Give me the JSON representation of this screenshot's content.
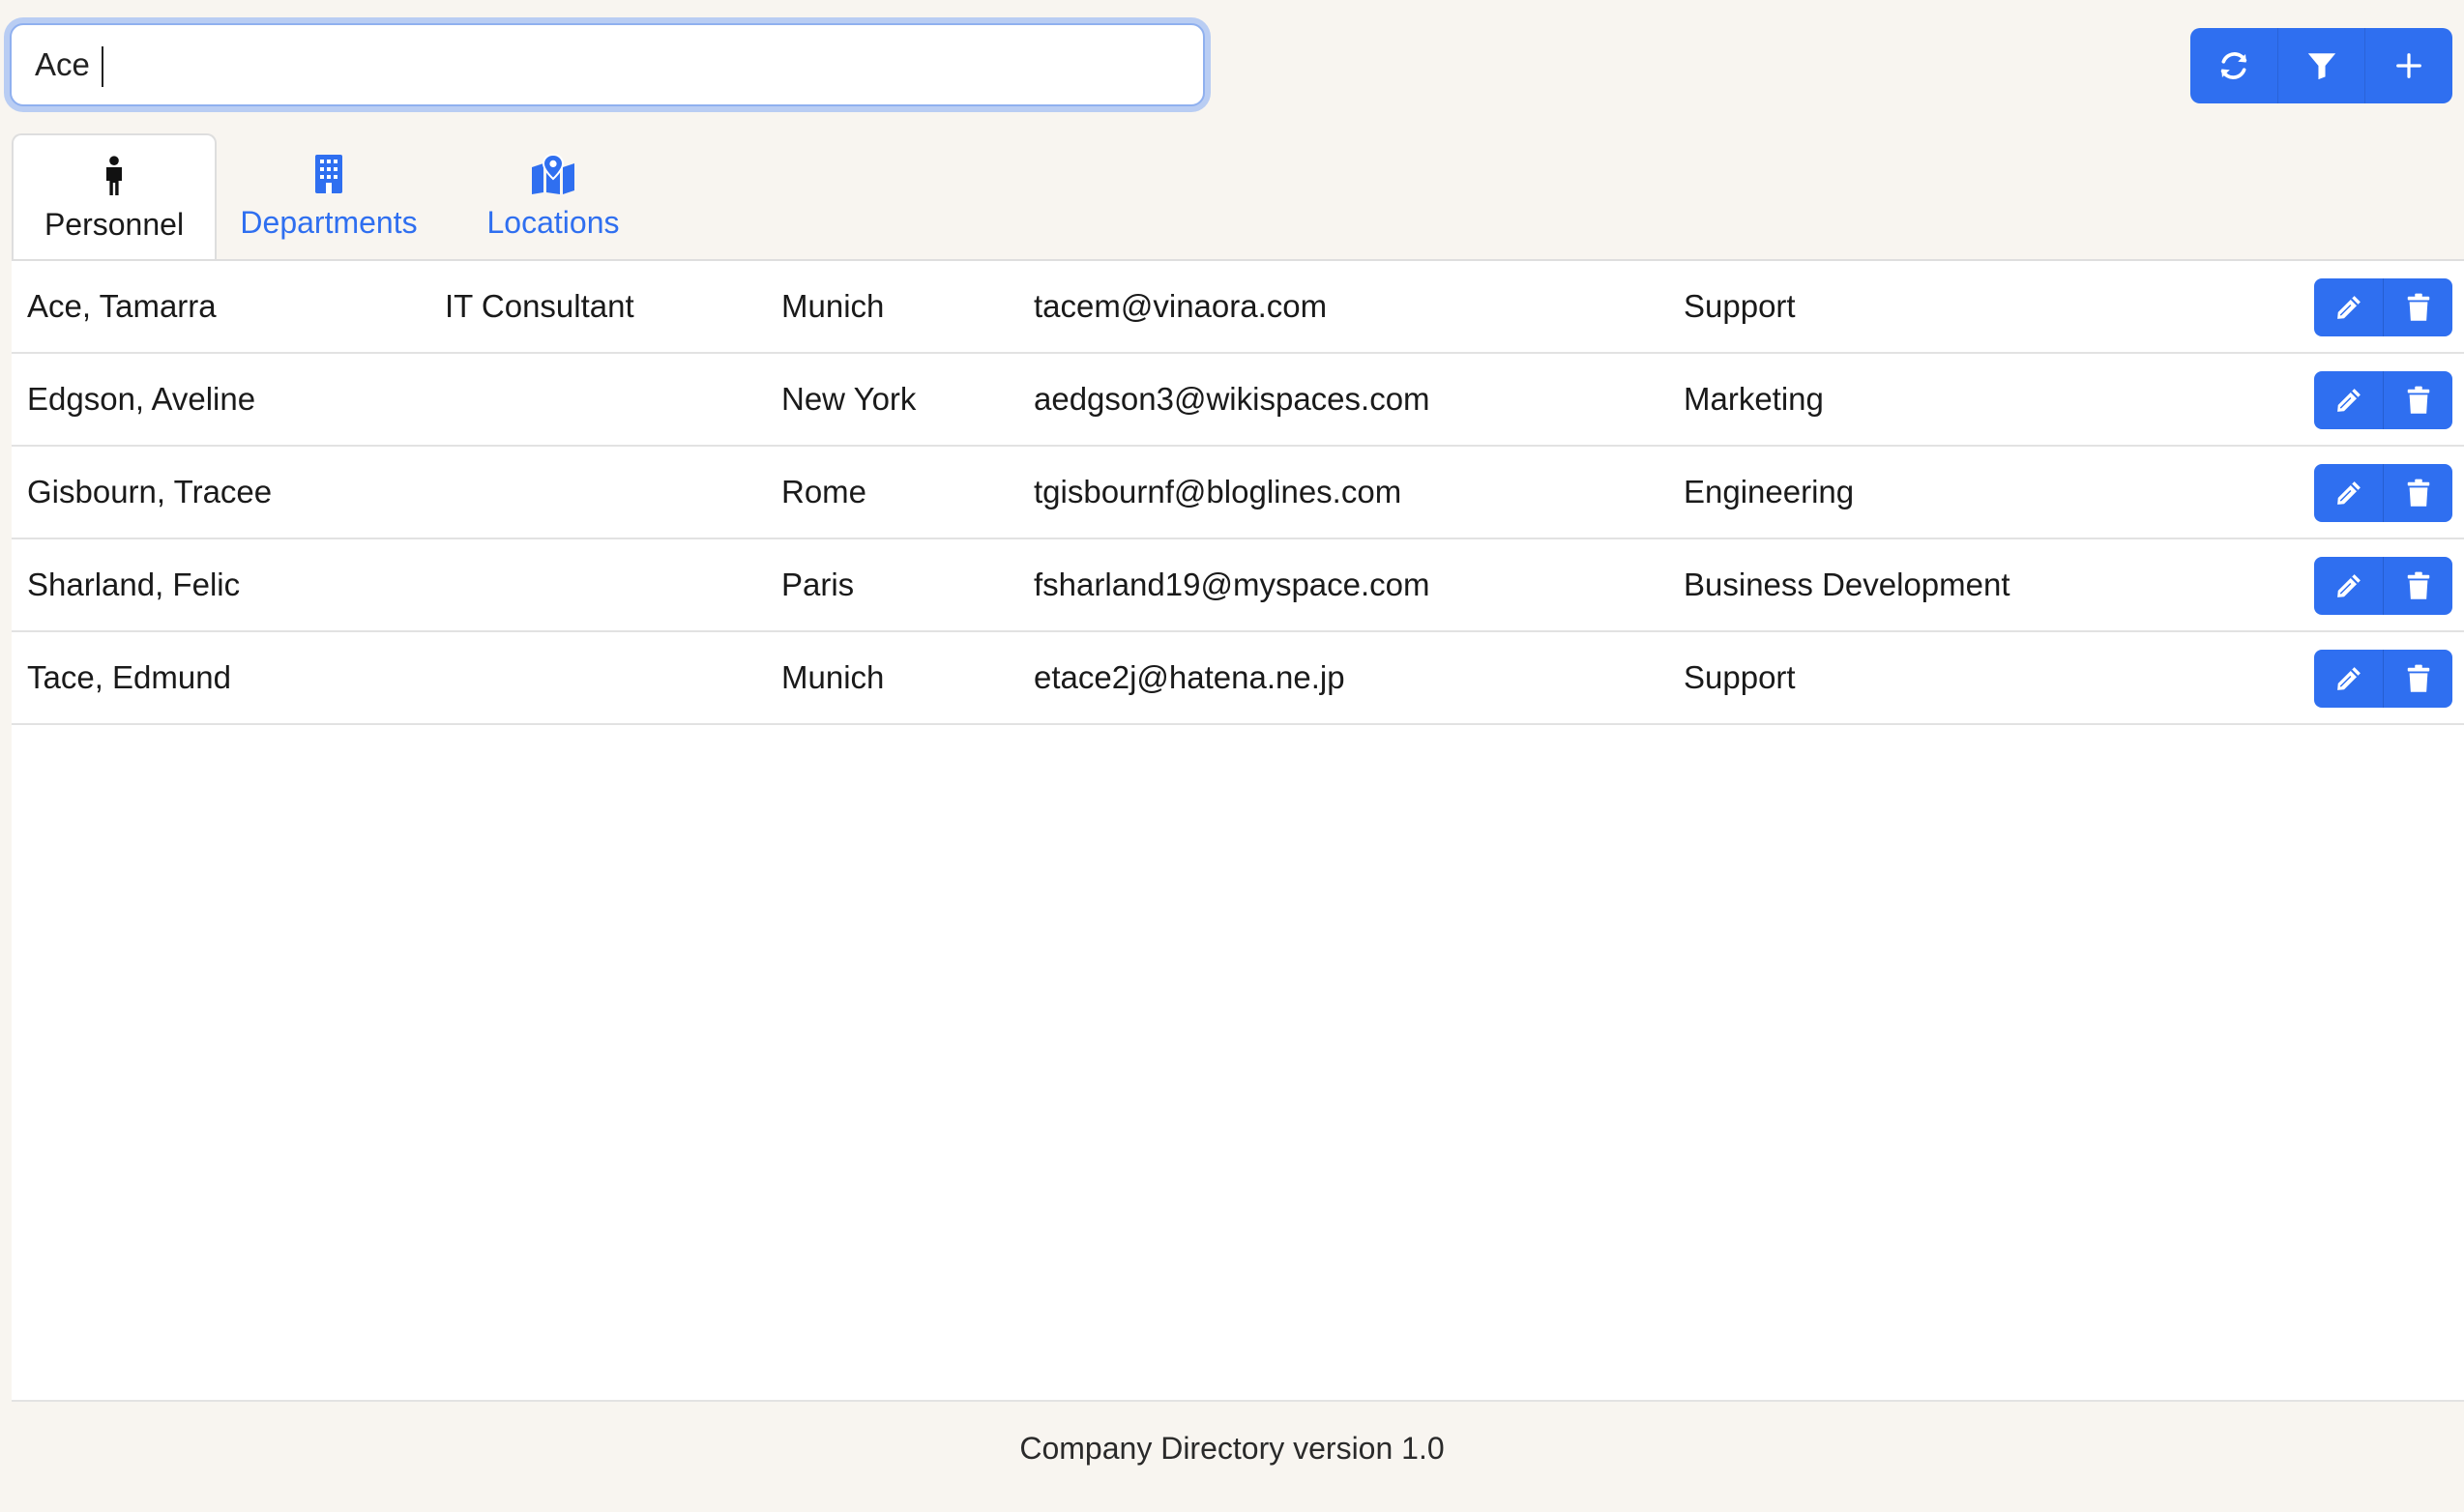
{
  "search": {
    "value": "Ace",
    "placeholder": ""
  },
  "toolbar": {
    "buttons": [
      {
        "icon": "refresh-icon"
      },
      {
        "icon": "filter-icon"
      },
      {
        "icon": "plus-icon"
      }
    ]
  },
  "tabs": [
    {
      "label": "Personnel",
      "icon": "person-icon",
      "active": true
    },
    {
      "label": "Departments",
      "icon": "building-icon",
      "active": false
    },
    {
      "label": "Locations",
      "icon": "map-location-icon",
      "active": false
    }
  ],
  "personnel": {
    "rows": [
      {
        "name": "Ace, Tamarra",
        "job_title": "IT Consultant",
        "location": "Munich",
        "email": "tacem@vinaora.com",
        "department": "Support"
      },
      {
        "name": "Edgson, Aveline",
        "job_title": "",
        "location": "New York",
        "email": "aedgson3@wikispaces.com",
        "department": "Marketing"
      },
      {
        "name": "Gisbourn, Tracee",
        "job_title": "",
        "location": "Rome",
        "email": "tgisbournf@bloglines.com",
        "department": "Engineering"
      },
      {
        "name": "Sharland, Felic",
        "job_title": "",
        "location": "Paris",
        "email": "fsharland19@myspace.com",
        "department": "Business Development"
      },
      {
        "name": "Tace, Edmund",
        "job_title": "",
        "location": "Munich",
        "email": "etace2j@hatena.ne.jp",
        "department": "Support"
      }
    ]
  },
  "footer": {
    "text": "Company Directory version 1.0"
  },
  "colors": {
    "accent": "#2f6ff0",
    "page_background": "#f8f5f0",
    "panel_background": "#ffffff"
  }
}
